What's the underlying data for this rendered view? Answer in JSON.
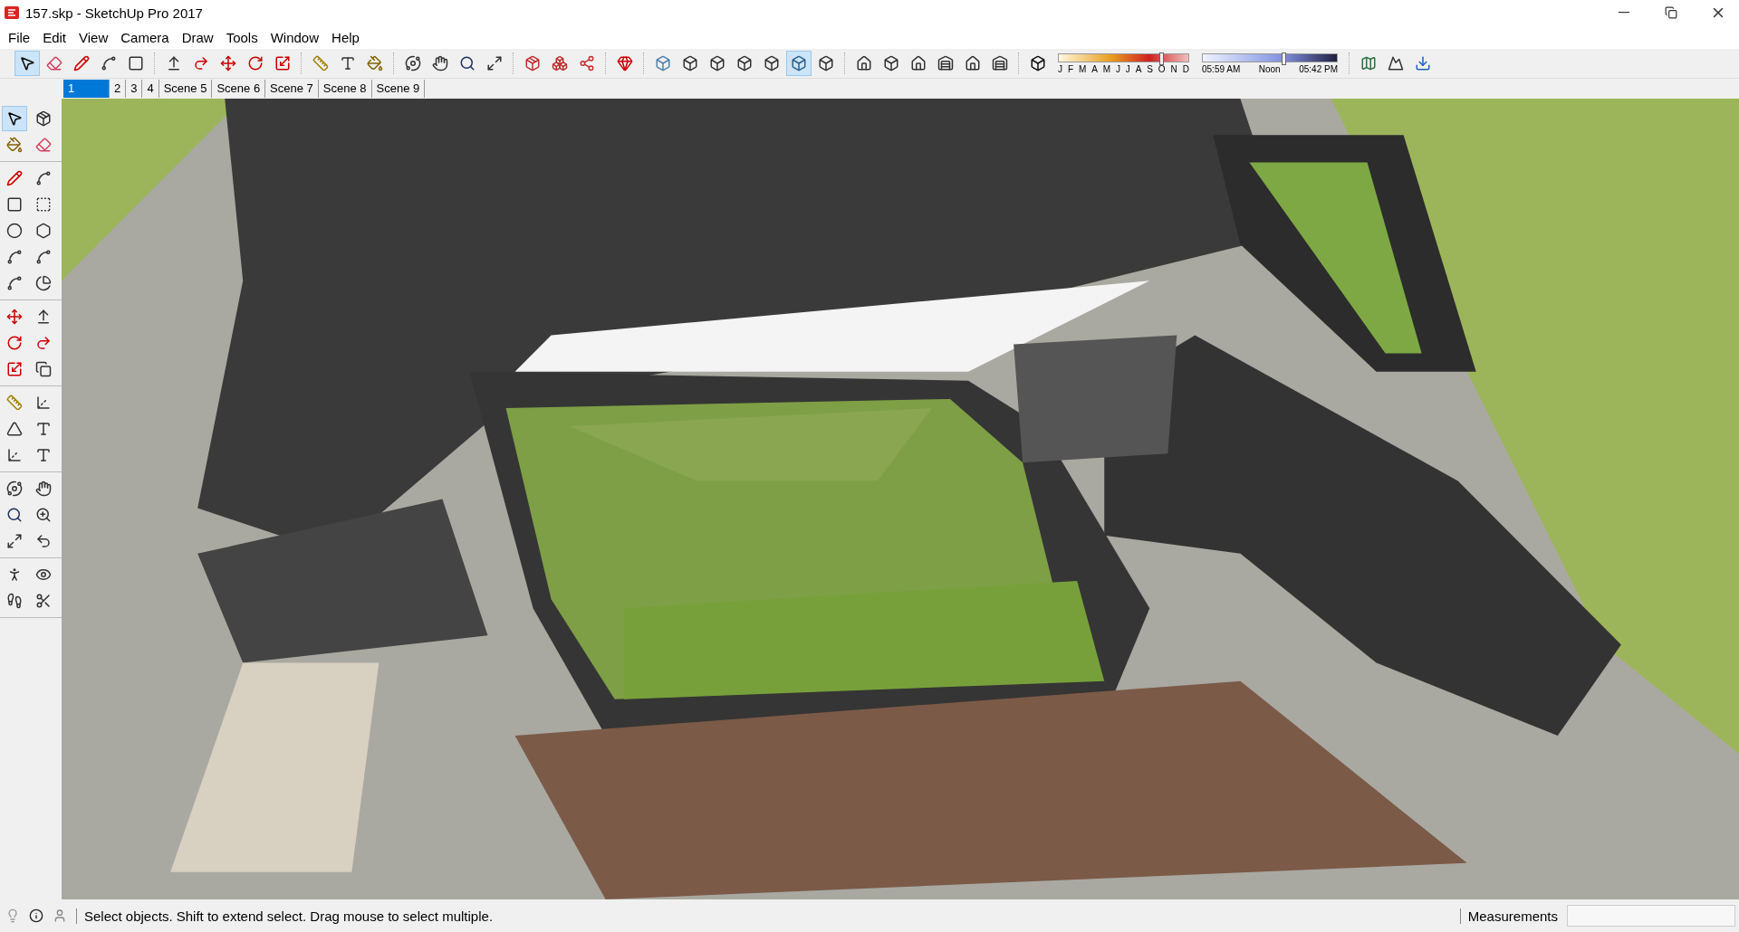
{
  "window": {
    "title": "157.skp - SketchUp Pro 2017"
  },
  "menu": [
    "File",
    "Edit",
    "View",
    "Camera",
    "Draw",
    "Tools",
    "Window",
    "Help"
  ],
  "toolbar": [
    {
      "kind": "select",
      "selected": true
    },
    {
      "kind": "eraser",
      "selected": false
    },
    {
      "kind": "pencil",
      "selected": false
    },
    {
      "kind": "arc",
      "selected": false
    },
    {
      "kind": "rectangle",
      "selected": false
    },
    {
      "kind": "sep"
    },
    {
      "kind": "pushpull",
      "selected": false
    },
    {
      "kind": "followme",
      "selected": false
    },
    {
      "kind": "move",
      "selected": false
    },
    {
      "kind": "rotate",
      "selected": false
    },
    {
      "kind": "scale",
      "selected": false
    },
    {
      "kind": "sep"
    },
    {
      "kind": "tape",
      "selected": false
    },
    {
      "kind": "text",
      "selected": false
    },
    {
      "kind": "paint",
      "selected": false
    },
    {
      "kind": "sep"
    },
    {
      "kind": "orbit",
      "selected": false
    },
    {
      "kind": "pan",
      "selected": false
    },
    {
      "kind": "zoom",
      "selected": false
    },
    {
      "kind": "extents",
      "selected": false
    },
    {
      "kind": "sep"
    },
    {
      "kind": "warehouse",
      "selected": false
    },
    {
      "kind": "components",
      "selected": false
    },
    {
      "kind": "share",
      "selected": false
    },
    {
      "kind": "sep"
    },
    {
      "kind": "ruby",
      "selected": false
    },
    {
      "kind": "sep"
    },
    {
      "kind": "xray",
      "selected": false
    },
    {
      "kind": "backedges",
      "selected": false
    },
    {
      "kind": "wireframe",
      "selected": false
    },
    {
      "kind": "hidden",
      "selected": false
    },
    {
      "kind": "shaded",
      "selected": false
    },
    {
      "kind": "textured",
      "selected": true
    },
    {
      "kind": "monochrome",
      "selected": false
    },
    {
      "kind": "sep"
    },
    {
      "kind": "iso",
      "selected": false
    },
    {
      "kind": "top",
      "selected": false
    },
    {
      "kind": "front",
      "selected": false
    },
    {
      "kind": "right",
      "selected": false
    },
    {
      "kind": "back",
      "selected": false
    },
    {
      "kind": "left",
      "selected": false
    }
  ],
  "shadows": {
    "months": [
      "J",
      "F",
      "M",
      "A",
      "M",
      "J",
      "J",
      "A",
      "S",
      "O",
      "N",
      "D"
    ],
    "month_slider": {
      "level": 0.79
    },
    "time_start": "05:59 AM",
    "time_mid": "Noon",
    "time_end": "05:42 PM",
    "time_slider": {
      "level": 0.6
    }
  },
  "toolbar_end": [
    {
      "kind": "geolocate"
    },
    {
      "kind": "terrain"
    },
    {
      "kind": "photo"
    }
  ],
  "scenes": [
    {
      "label": "1",
      "selected": true
    },
    {
      "label": "2",
      "selected": false
    },
    {
      "label": "3",
      "selected": false
    },
    {
      "label": "4",
      "selected": false
    },
    {
      "label": "Scene 5",
      "selected": false
    },
    {
      "label": "Scene 6",
      "selected": false
    },
    {
      "label": "Scene 7",
      "selected": false
    },
    {
      "label": "Scene 8",
      "selected": false
    },
    {
      "label": "Scene 9",
      "selected": false
    }
  ],
  "side_tools": [
    [
      {
        "kind": "select",
        "selected": true
      },
      {
        "kind": "component",
        "selected": false
      },
      {
        "kind": "paint",
        "selected": false
      },
      {
        "kind": "eraser",
        "selected": false
      }
    ],
    [
      {
        "kind": "pencil",
        "selected": false
      },
      {
        "kind": "freehand",
        "selected": false
      },
      {
        "kind": "rectangle",
        "selected": false
      },
      {
        "kind": "rotrect",
        "selected": false
      },
      {
        "kind": "circle",
        "selected": false
      },
      {
        "kind": "polygon",
        "selected": false
      },
      {
        "kind": "arc",
        "selected": false
      },
      {
        "kind": "arc2",
        "selected": false
      },
      {
        "kind": "arc3",
        "selected": false
      },
      {
        "kind": "pie",
        "selected": false
      }
    ],
    [
      {
        "kind": "move",
        "selected": false
      },
      {
        "kind": "pushpull",
        "selected": false
      },
      {
        "kind": "rotate",
        "selected": false
      },
      {
        "kind": "followme",
        "selected": false
      },
      {
        "kind": "scale",
        "selected": false
      },
      {
        "kind": "offset",
        "selected": false
      }
    ],
    [
      {
        "kind": "tape",
        "selected": false
      },
      {
        "kind": "dimension",
        "selected": false
      },
      {
        "kind": "protractor",
        "selected": false
      },
      {
        "kind": "text",
        "selected": false
      },
      {
        "kind": "axes",
        "selected": false
      },
      {
        "kind": "text3d",
        "selected": false
      }
    ],
    [
      {
        "kind": "orbit",
        "selected": false
      },
      {
        "kind": "pan",
        "selected": false
      },
      {
        "kind": "zoom",
        "selected": false
      },
      {
        "kind": "zoomwindow",
        "selected": false
      },
      {
        "kind": "extents",
        "selected": false
      },
      {
        "kind": "previous",
        "selected": false
      }
    ],
    [
      {
        "kind": "position",
        "selected": false
      },
      {
        "kind": "lookaround",
        "selected": false
      },
      {
        "kind": "walk",
        "selected": false
      },
      {
        "kind": "section",
        "selected": false
      }
    ]
  ],
  "status_bar": {
    "message": "Select objects. Shift to extend select. Drag mouse to select multiple.",
    "measurements_label": "Measurements"
  }
}
